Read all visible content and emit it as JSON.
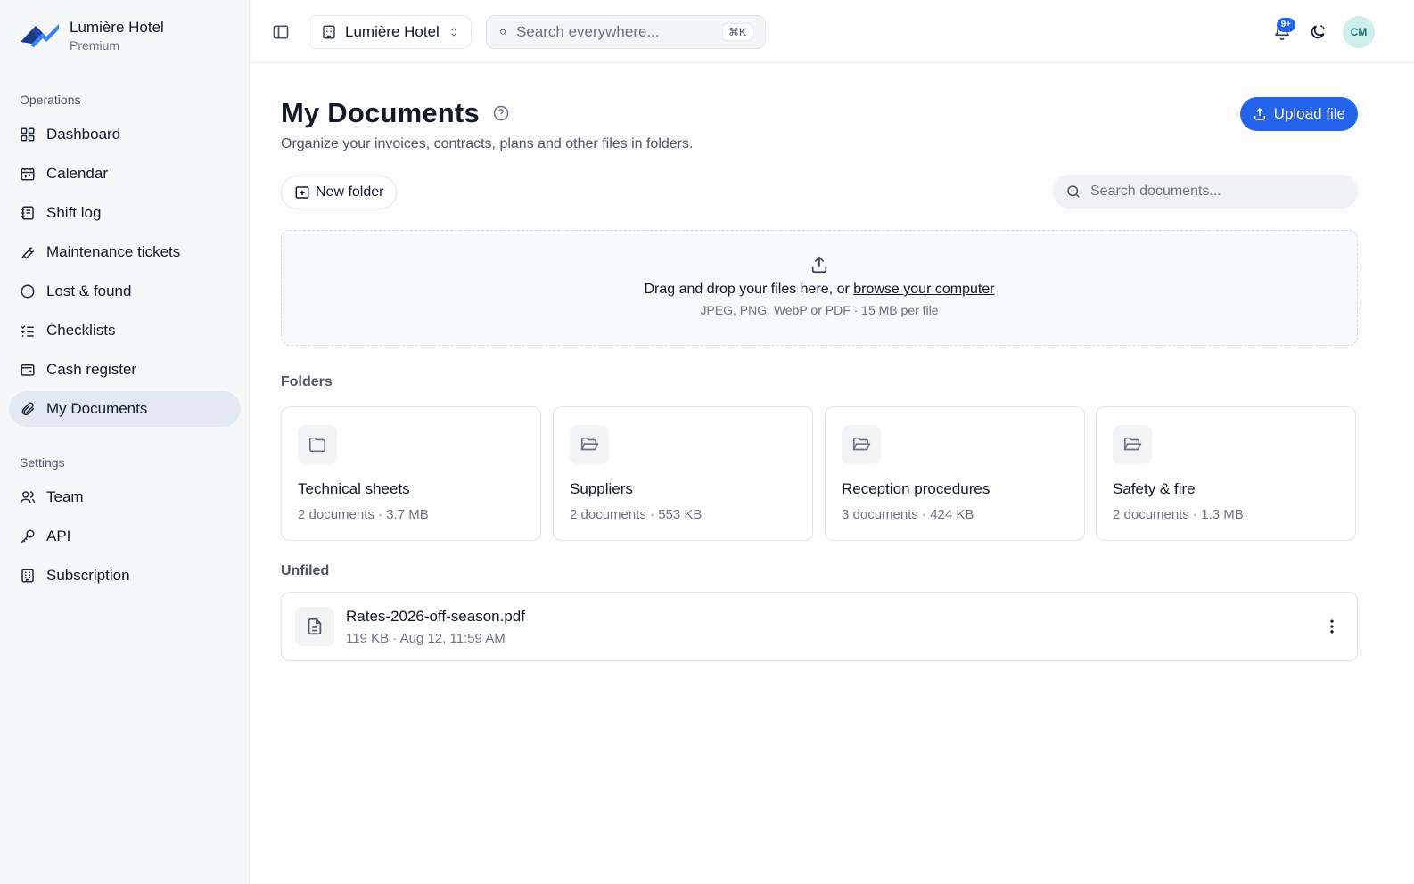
{
  "brand": {
    "name": "Lumière Hotel",
    "plan": "Premium"
  },
  "sidebar": {
    "operations_label": "Operations",
    "operations": [
      {
        "label": "Dashboard",
        "icon": "grid-icon"
      },
      {
        "label": "Calendar",
        "icon": "calendar-icon"
      },
      {
        "label": "Shift log",
        "icon": "logbook-icon"
      },
      {
        "label": "Maintenance tickets",
        "icon": "wrench-icon"
      },
      {
        "label": "Lost & found",
        "icon": "circle-icon"
      },
      {
        "label": "Checklists",
        "icon": "checklist-icon"
      },
      {
        "label": "Cash register",
        "icon": "wallet-icon"
      },
      {
        "label": "My Documents",
        "icon": "paperclip-icon",
        "active": true
      }
    ],
    "settings_label": "Settings",
    "settings": [
      {
        "label": "Team",
        "icon": "users-icon"
      },
      {
        "label": "API",
        "icon": "key-icon"
      },
      {
        "label": "Subscription",
        "icon": "building-icon"
      }
    ]
  },
  "topbar": {
    "hotel_select": "Lumière Hotel",
    "search_placeholder": "Search everywhere...",
    "search_shortcut": "⌘K",
    "notifications_badge": "9+",
    "avatar_initials": "CM"
  },
  "main": {
    "title": "My Documents",
    "subtitle": "Organize your invoices, contracts, plans and other files in folders.",
    "upload_label": "Upload file",
    "new_folder_label": "New folder",
    "doc_search_placeholder": "Search documents...",
    "dropzone": {
      "text": "Drag and drop your files here, or",
      "link": "browse your computer",
      "hint": "JPEG, PNG, WebP or PDF · 15 MB per file"
    },
    "folders_label": "Folders",
    "folders": [
      {
        "name": "Technical sheets",
        "meta": "2 documents · 3.7 MB"
      },
      {
        "name": "Suppliers",
        "meta": "2 documents · 553 KB"
      },
      {
        "name": "Reception procedures",
        "meta": "3 documents · 424 KB"
      },
      {
        "name": "Safety & fire",
        "meta": "2 documents · 1.3 MB"
      }
    ],
    "unfiled_label": "Unfiled",
    "files": [
      {
        "name": "Rates-2026-off-season.pdf",
        "meta": "119 KB · Aug 12, 11:59 AM"
      }
    ]
  },
  "colors": {
    "accent": "#2563eb",
    "active_nav": "#e3e9f2",
    "avatar_bg": "#cdeee9",
    "brand_dark": "#1e3a8a",
    "brand_light": "#3b82f6"
  }
}
